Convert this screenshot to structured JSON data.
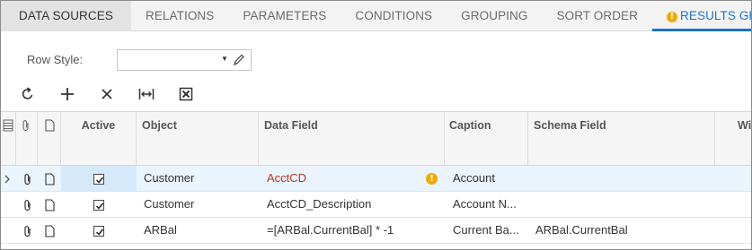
{
  "tabs": [
    {
      "label": "DATA SOURCES",
      "state": "selected"
    },
    {
      "label": "RELATIONS"
    },
    {
      "label": "PARAMETERS"
    },
    {
      "label": "CONDITIONS"
    },
    {
      "label": "GROUPING"
    },
    {
      "label": "SORT ORDER"
    },
    {
      "label": "RESULTS GRID",
      "state": "active",
      "icon": "warning-icon"
    }
  ],
  "form": {
    "row_style_label": "Row Style:",
    "row_style_value": ""
  },
  "toolbar": {
    "buttons": [
      "refresh-icon",
      "add-icon",
      "delete-icon",
      "fit-columns-icon",
      "export-excel-icon"
    ]
  },
  "grid": {
    "columns": {
      "active": "Active",
      "object": "Object",
      "data_field": "Data Field",
      "caption": "Caption",
      "schema_field": "Schema Field",
      "width": "Wi"
    },
    "rows": [
      {
        "active": true,
        "object": "Customer",
        "data_field": "AcctCD",
        "caption": "Account",
        "schema_field": "",
        "selected": true,
        "warning": true
      },
      {
        "active": true,
        "object": "Customer",
        "data_field": "AcctCD_Description",
        "caption": "Account N...",
        "schema_field": ""
      },
      {
        "active": true,
        "object": "ARBal",
        "data_field": "=[ARBal.CurrentBal] * -1",
        "caption": "Current Ba...",
        "schema_field": "ARBal.CurrentBal"
      }
    ]
  },
  "colors": {
    "accent": "#1a73c9",
    "warning": "#f2a900",
    "error_text": "#b8361e",
    "selected_row": "#eaf4fd"
  }
}
